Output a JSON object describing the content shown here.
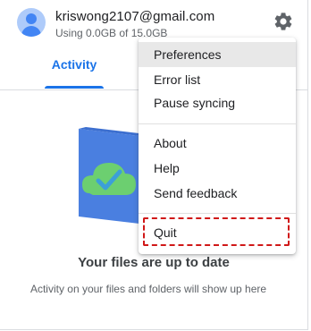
{
  "account": {
    "email": "kriswong2107@gmail.com",
    "usage": "Using 0.0GB of 15.0GB"
  },
  "tabs": [
    {
      "label": "Activity",
      "selected": true
    }
  ],
  "status": {
    "title": "Your files are up to date",
    "note": "Activity on your files and folders will show up here"
  },
  "menu": {
    "items": [
      {
        "label": "Preferences",
        "highlighted": true
      },
      {
        "label": "Error list"
      },
      {
        "label": "Pause syncing"
      },
      {
        "label": "About"
      },
      {
        "label": "Help"
      },
      {
        "label": "Send feedback"
      },
      {
        "label": "Quit",
        "outlined": true
      }
    ]
  },
  "icons": {
    "settings": "gear-icon",
    "avatar": "account-avatar",
    "illustration": "cloud-check-illustration"
  },
  "colors": {
    "accent": "#1a73e8",
    "highlight_outline": "#d01818",
    "illustration_folder": "#4a7fe0",
    "illustration_cloud": "#6ccf70"
  }
}
